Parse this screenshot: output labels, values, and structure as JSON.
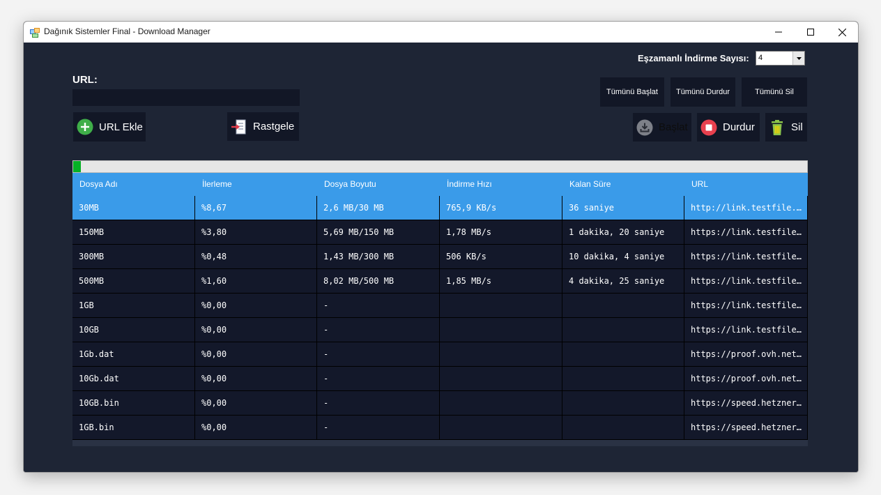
{
  "window": {
    "title": "Dağınık Sistemler Final - Download Manager"
  },
  "concurrency": {
    "label": "Eşzamanlı İndirme Sayısı:",
    "value": "4"
  },
  "url_section": {
    "label": "URL:",
    "value": ""
  },
  "buttons": {
    "start_all": "Tümünü Başlat",
    "stop_all": "Tümünü Durdur",
    "delete_all": "Tümünü Sil",
    "add_url": "URL Ekle",
    "random": "Rastgele",
    "start": "Başlat",
    "stop": "Durdur",
    "delete": "Sil"
  },
  "icons": {
    "add_url": "plus-circle-icon",
    "random": "import-file-icon",
    "start": "download-icon",
    "stop": "stop-icon",
    "delete": "trash-icon"
  },
  "colors": {
    "background": "#1e2535",
    "button": "#121726",
    "header": "#3a9be9",
    "selected_row": "#3a9be9",
    "row": "#13182a",
    "progress": "#06b025",
    "add_icon": "#3fae49",
    "stop_icon": "#e8404e",
    "delete_icon": "#8bc34a"
  },
  "overall_progress": 0.01,
  "table": {
    "columns": [
      "Dosya Adı",
      "İlerleme",
      "Dosya Boyutu",
      "İndirme Hızı",
      "Kalan Süre",
      "URL"
    ],
    "rows": [
      [
        "30MB",
        "%8,67",
        "2,6 MB/30 MB",
        "765,9 KB/s",
        "36 saniye",
        "http://link.testfile.org..."
      ],
      [
        "150MB",
        "%3,80",
        "5,69 MB/150 MB",
        "1,78 MB/s",
        "1 dakika, 20 saniye",
        "https://link.testfile.or..."
      ],
      [
        "300MB",
        "%0,48",
        "1,43 MB/300 MB",
        "506 KB/s",
        "10 dakika, 4 saniye",
        "https://link.testfile.or..."
      ],
      [
        "500MB",
        "%1,60",
        "8,02 MB/500 MB",
        "1,85 MB/s",
        "4 dakika, 25 saniye",
        "https://link.testfile.or..."
      ],
      [
        "1GB",
        "%0,00",
        "-",
        "",
        "",
        "https://link.testfile.or..."
      ],
      [
        "10GB",
        "%0,00",
        "-",
        "",
        "",
        "https://link.testfile.or..."
      ],
      [
        "1Gb.dat",
        "%0,00",
        "-",
        "",
        "",
        "https://proof.ovh.net/..."
      ],
      [
        "10Gb.dat",
        "%0,00",
        "-",
        "",
        "",
        "https://proof.ovh.net/..."
      ],
      [
        "10GB.bin",
        "%0,00",
        "-",
        "",
        "",
        "https://speed.hetzner...."
      ],
      [
        "1GB.bin",
        "%0,00",
        "-",
        "",
        "",
        "https://speed.hetzner...."
      ]
    ],
    "selected_row": 0
  }
}
